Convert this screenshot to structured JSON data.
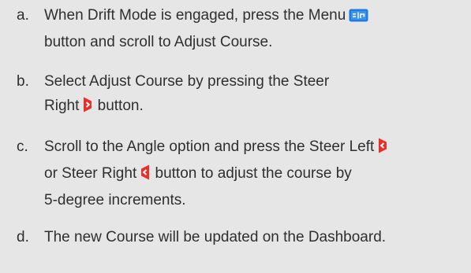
{
  "steps": [
    {
      "letter": "a.",
      "lines": [
        [
          "When Drift Mode is engaged, press the Menu",
          "menu-button-icon",
          ""
        ],
        [
          "button and scroll to Adjust Course.",
          "",
          ""
        ]
      ]
    },
    {
      "letter": "b.",
      "lines": [
        [
          "Select Adjust Course by pressing the Steer",
          "",
          ""
        ],
        [
          "Right",
          "steer-right-button-icon",
          "button."
        ]
      ]
    },
    {
      "letter": "c.",
      "lines": [
        [
          "Scroll to the Angle option and press the Steer Left",
          "steer-left-button-icon",
          ""
        ],
        [
          "or Steer Right",
          "steer-right-button-icon",
          "button to adjust the course by"
        ],
        [
          "5-degree increments.",
          "",
          ""
        ]
      ]
    },
    {
      "letter": "d.",
      "lines": [
        [
          "The new Course will be updated on the Dashboard.",
          "",
          ""
        ]
      ]
    }
  ],
  "colors": {
    "background": "#e6e6e6",
    "text": "#2f2f2f",
    "menu_icon": "#1e7be0",
    "steer_icon": "#e8302b"
  }
}
